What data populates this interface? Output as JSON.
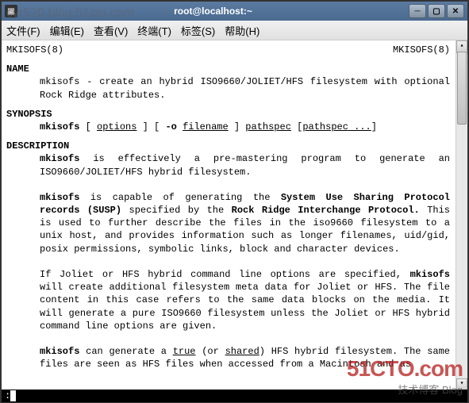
{
  "watermark": "cyr520.blog.51cto.com",
  "window": {
    "title": "root@localhost:~"
  },
  "menubar": {
    "file": "文件(F)",
    "edit": "编辑(E)",
    "view": "查看(V)",
    "terminal": "终端(T)",
    "tabs": "标签(S)",
    "help": "帮助(H)"
  },
  "man": {
    "header_left": "MKISOFS(8)",
    "header_right": "MKISOFS(8)",
    "sec_name": "NAME",
    "name_text": "mkisofs  - create an hybrid ISO9660/JOLIET/HFS filesystem with optional Rock Ridge attributes.",
    "sec_synopsis": "SYNOPSIS",
    "syn_cmd": "mkisofs",
    "syn_lb1": " [ ",
    "syn_options": "options",
    "syn_rb1": " ] [ ",
    "syn_oflag": "-o",
    "syn_sp": " ",
    "syn_filename": "filename",
    "syn_rb2": " ] ",
    "syn_pathspec": "pathspec",
    "syn_lb3": " [",
    "syn_pathspec2": "pathspec",
    "syn_dots": " ...",
    "syn_rb3": "]",
    "sec_desc": "DESCRIPTION",
    "desc_p1a": "mkisofs",
    "desc_p1b": "  is  effectively  a  pre-mastering  program  to   generate   an ISO9660/JOLIET/HFS hybrid filesystem.",
    "desc_p2a": "mkisofs",
    "desc_p2b": "  is  capable  of  generating  the  ",
    "desc_p2c": "System  Use Sharing Protocol records (SUSP)",
    "desc_p2d": " specified by the ",
    "desc_p2e": "Rock Ridge Interchange Protocol.",
    "desc_p2f": "   This is  used  to  further describe the files in the iso9660 filesystem to a unix host, and provides information such as longer filenames,  uid/gid, posix permissions, symbolic links, block and character devices.",
    "desc_p3a": "If  Joliet  or  HFS  hybrid command line options are specified, ",
    "desc_p3b": "mkisofs",
    "desc_p3c": " will create additional filesystem meta data for  Joliet  or  HFS.   The file  content in this case refers to the same data blocks on the media. It will generate a pure ISO9660 filesystem unless  the  Joliet  or  HFS hybrid command line options are given.",
    "desc_p4a": "mkisofs",
    "desc_p4b": " can generate a ",
    "desc_p4c": "true",
    "desc_p4d": " (or ",
    "desc_p4e": "shared",
    "desc_p4f": ") HFS hybrid filesystem. The same files are seen as HFS files when  accessed  from  a  Macintosh  and  as"
  },
  "status": ":",
  "overlay": {
    "logo_big": "51CTO.com",
    "logo_small": "技术博客    Blog"
  }
}
